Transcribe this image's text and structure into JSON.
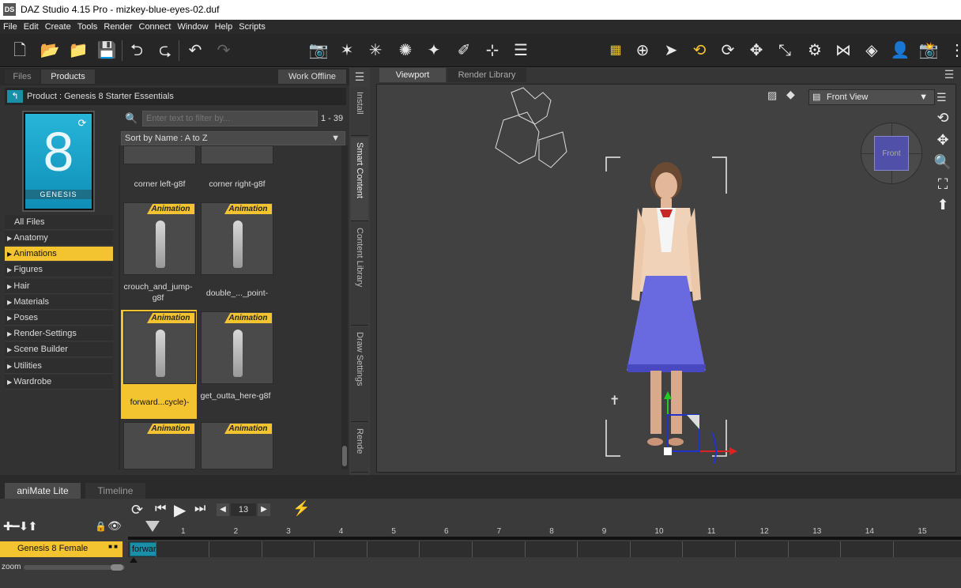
{
  "window": {
    "title": "DAZ Studio 4.15 Pro - mizkey-blue-eyes-02.duf",
    "icon_text": "DS"
  },
  "menu": [
    "File",
    "Edit",
    "Create",
    "Tools",
    "Render",
    "Connect",
    "Window",
    "Help",
    "Scripts"
  ],
  "toolbar_icons": [
    "new-file-icon",
    "open-folder-icon",
    "open-recent-icon",
    "save-icon",
    "import-icon",
    "export-icon",
    "undo-icon",
    "redo-icon"
  ],
  "left_panel": {
    "tabs": {
      "files": "Files",
      "products": "Products",
      "work_offline": "Work Offline"
    },
    "product_label": "Product :  Genesis 8 Starter Essentials",
    "thumb_caption": "GENESIS",
    "thumb_number": "8",
    "filter_placeholder": "Enter text to filter by...",
    "count": "1 - 39",
    "sort": "Sort by Name : A to Z",
    "all_files": "All Files",
    "categories": [
      "Anatomy",
      "Animations",
      "Figures",
      "Hair",
      "Materials",
      "Poses",
      "Render-Settings",
      "Scene Builder",
      "Utilities",
      "Wardrobe"
    ],
    "assets": [
      {
        "label": "corner left-g8f"
      },
      {
        "label": "corner right-g8f"
      },
      {
        "label": "crouch_and_jump-g8f",
        "badge": "Animation"
      },
      {
        "label": "double_..._point-",
        "badge": "Animation"
      },
      {
        "label": "forward...cycle)-",
        "badge": "Animation"
      },
      {
        "label": "get_outta_here-g8f",
        "badge": "Animation"
      },
      {
        "label": "",
        "badge": "Animation"
      },
      {
        "label": "",
        "badge": "Animation"
      }
    ],
    "side_tabs": [
      "Install",
      "Smart Content",
      "Content Library",
      "Draw Settings",
      "Rende"
    ]
  },
  "viewport": {
    "tabs": {
      "viewport": "Viewport",
      "render_library": "Render Library"
    },
    "view_select": "Front View",
    "cube_label": "Front"
  },
  "timeline": {
    "tabs": {
      "animate": "aniMate Lite",
      "timeline": "Timeline"
    },
    "frame": "13",
    "ticks": [
      "1",
      "2",
      "3",
      "4",
      "5",
      "6",
      "7",
      "8",
      "9",
      "10",
      "11",
      "12",
      "13",
      "14",
      "15"
    ],
    "track_name": "Genesis 8 Female",
    "clip_label": "forward (1 cyc",
    "zoom_label": "zoom"
  },
  "colors": {
    "accent": "#f4c430",
    "teal": "#1a8fa8"
  }
}
